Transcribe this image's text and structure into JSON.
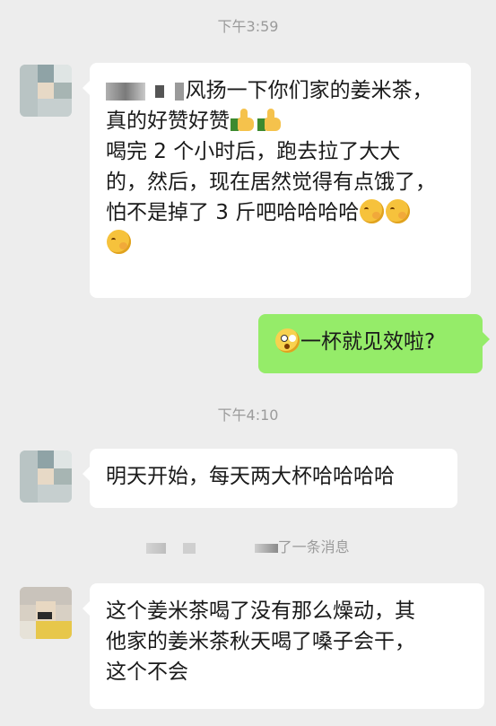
{
  "timestamps": [
    "下午3:59",
    "下午4:10"
  ],
  "messages": {
    "m1": {
      "line1": "风扬一下你们家的姜米茶，",
      "line2": "真的好赞好赞",
      "line3": "喝完 2 个小时后，跑去拉了大大",
      "line4": "的，然后，现在居然觉得有点饿了，",
      "line5": "怕不是掉了 3 斤吧哈哈哈哈"
    },
    "m2": {
      "text": "一杯就见效啦?"
    },
    "m3": {
      "text": "明天开始，每天两大杯哈哈哈哈"
    },
    "m4": {
      "line1": "这个姜米茶喝了没有那么燥动，其",
      "line2": "他家的姜米茶秋天喝了嗓子会干，",
      "line3": "这个不会"
    }
  },
  "system_notice": "了一条消息",
  "icons": {
    "thumbs_up": "thumbs-up-icon",
    "blush": "blush-emoji-icon",
    "surprise": "surprise-emoji-icon"
  },
  "colors": {
    "background": "#ededed",
    "bubble_left": "#ffffff",
    "bubble_right": "#95ec69",
    "timestamp": "#9b9b9b"
  }
}
